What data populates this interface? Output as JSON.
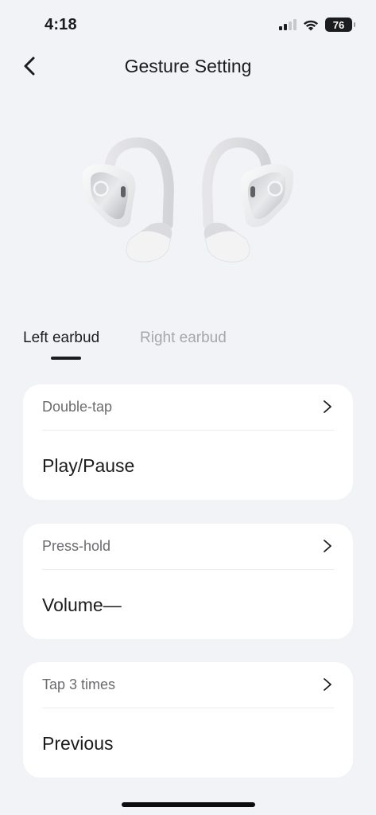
{
  "status_bar": {
    "time": "4:18",
    "battery_level": "76",
    "icons": [
      "cellular-signal-icon",
      "wifi-icon",
      "battery-icon"
    ]
  },
  "nav": {
    "title": "Gesture Setting",
    "back_icon": "chevron-left-icon"
  },
  "hero": {
    "image": "earbuds-image"
  },
  "tabs": [
    {
      "label": "Left earbud",
      "selected": true
    },
    {
      "label": "Right earbud",
      "selected": false
    }
  ],
  "gestures": [
    {
      "label": "Double-tap",
      "value": "Play/Pause"
    },
    {
      "label": "Press-hold",
      "value": "Volume—"
    },
    {
      "label": "Tap 3 times",
      "value": "Previous"
    }
  ],
  "colors": {
    "background": "#f2f3f7",
    "card": "#ffffff",
    "text_primary": "#1c1c1e",
    "text_secondary": "#6b6b70",
    "tab_inactive": "#a6a6ab"
  }
}
